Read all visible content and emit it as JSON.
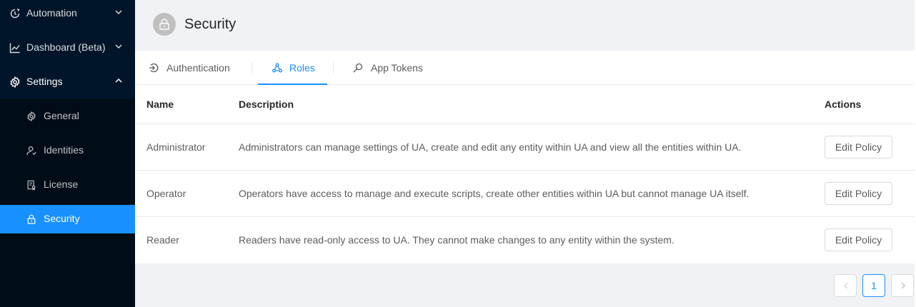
{
  "sidebar": {
    "menu": [
      {
        "label": "Automation",
        "icon": "automation-icon"
      },
      {
        "label": "Dashboard (Beta)",
        "icon": "line-chart-icon"
      },
      {
        "label": "Settings",
        "icon": "gear-icon"
      }
    ],
    "submenu": [
      {
        "label": "General",
        "icon": "gear-icon"
      },
      {
        "label": "Identities",
        "icon": "user-icon"
      },
      {
        "label": "License",
        "icon": "license-icon"
      },
      {
        "label": "Security",
        "icon": "lock-icon",
        "active": true
      }
    ]
  },
  "header": {
    "title": "Security",
    "avatar_icon": "lock-icon"
  },
  "tabs": [
    {
      "label": "Authentication",
      "icon": "login-icon"
    },
    {
      "label": "Roles",
      "icon": "cluster-icon",
      "active": true
    },
    {
      "label": "App Tokens",
      "icon": "search-icon"
    }
  ],
  "table": {
    "columns": [
      "Name",
      "Description",
      "Actions"
    ],
    "rows": [
      {
        "name": "Administrator",
        "description": "Administrators can manage settings of UA, create and edit any entity within UA and view all the entities within UA.",
        "action": "Edit Policy"
      },
      {
        "name": "Operator",
        "description": "Operators have access to manage and execute scripts, create other entities within UA but cannot manage UA itself.",
        "action": "Edit Policy"
      },
      {
        "name": "Reader",
        "description": "Readers have read-only access to UA. They cannot make changes to any entity within the system.",
        "action": "Edit Policy"
      }
    ]
  },
  "pagination": {
    "current": "1"
  },
  "colors": {
    "sidebar_bg": "#001529",
    "submenu_bg": "#000c17",
    "accent": "#1890ff"
  }
}
